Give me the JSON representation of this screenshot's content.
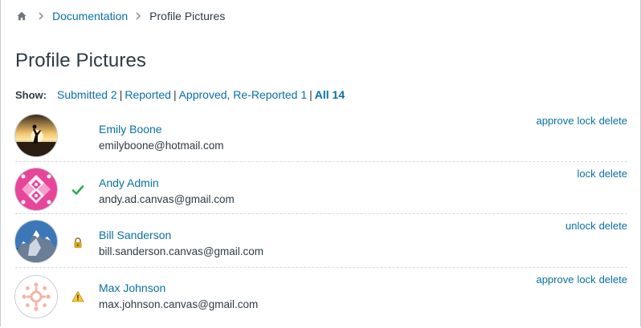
{
  "breadcrumb": {
    "home_icon": "home-icon",
    "items": [
      "Documentation",
      "Profile Pictures"
    ]
  },
  "page": {
    "title": "Profile Pictures"
  },
  "filters": {
    "label": "Show:",
    "options": [
      {
        "label": "Submitted 2",
        "active": false
      },
      {
        "label": "Reported",
        "active": false
      },
      {
        "label": "Approved, Re-Reported 1",
        "active": false
      },
      {
        "label": "All 14",
        "active": true
      }
    ]
  },
  "colors": {
    "link": "#0770a3",
    "text": "#2d3b45",
    "check": "#2bab4a",
    "lock": "#d7a11b",
    "warning": "#fcc934"
  },
  "users": [
    {
      "name": "Emily Boone",
      "email": "emilyboone@hotmail.com",
      "status_icon": "",
      "actions": [
        "approve",
        "lock",
        "delete"
      ]
    },
    {
      "name": "Andy Admin",
      "email": "andy.ad.canvas@gmail.com",
      "status_icon": "checkmark-icon",
      "actions": [
        "lock",
        "delete"
      ]
    },
    {
      "name": "Bill Sanderson",
      "email": "bill.sanderson.canvas@gmail.com",
      "status_icon": "lock-icon",
      "actions": [
        "unlock",
        "delete"
      ]
    },
    {
      "name": "Max Johnson",
      "email": "max.johnson.canvas@gmail.com",
      "status_icon": "warning-icon",
      "actions": [
        "approve",
        "lock",
        "delete"
      ]
    }
  ]
}
